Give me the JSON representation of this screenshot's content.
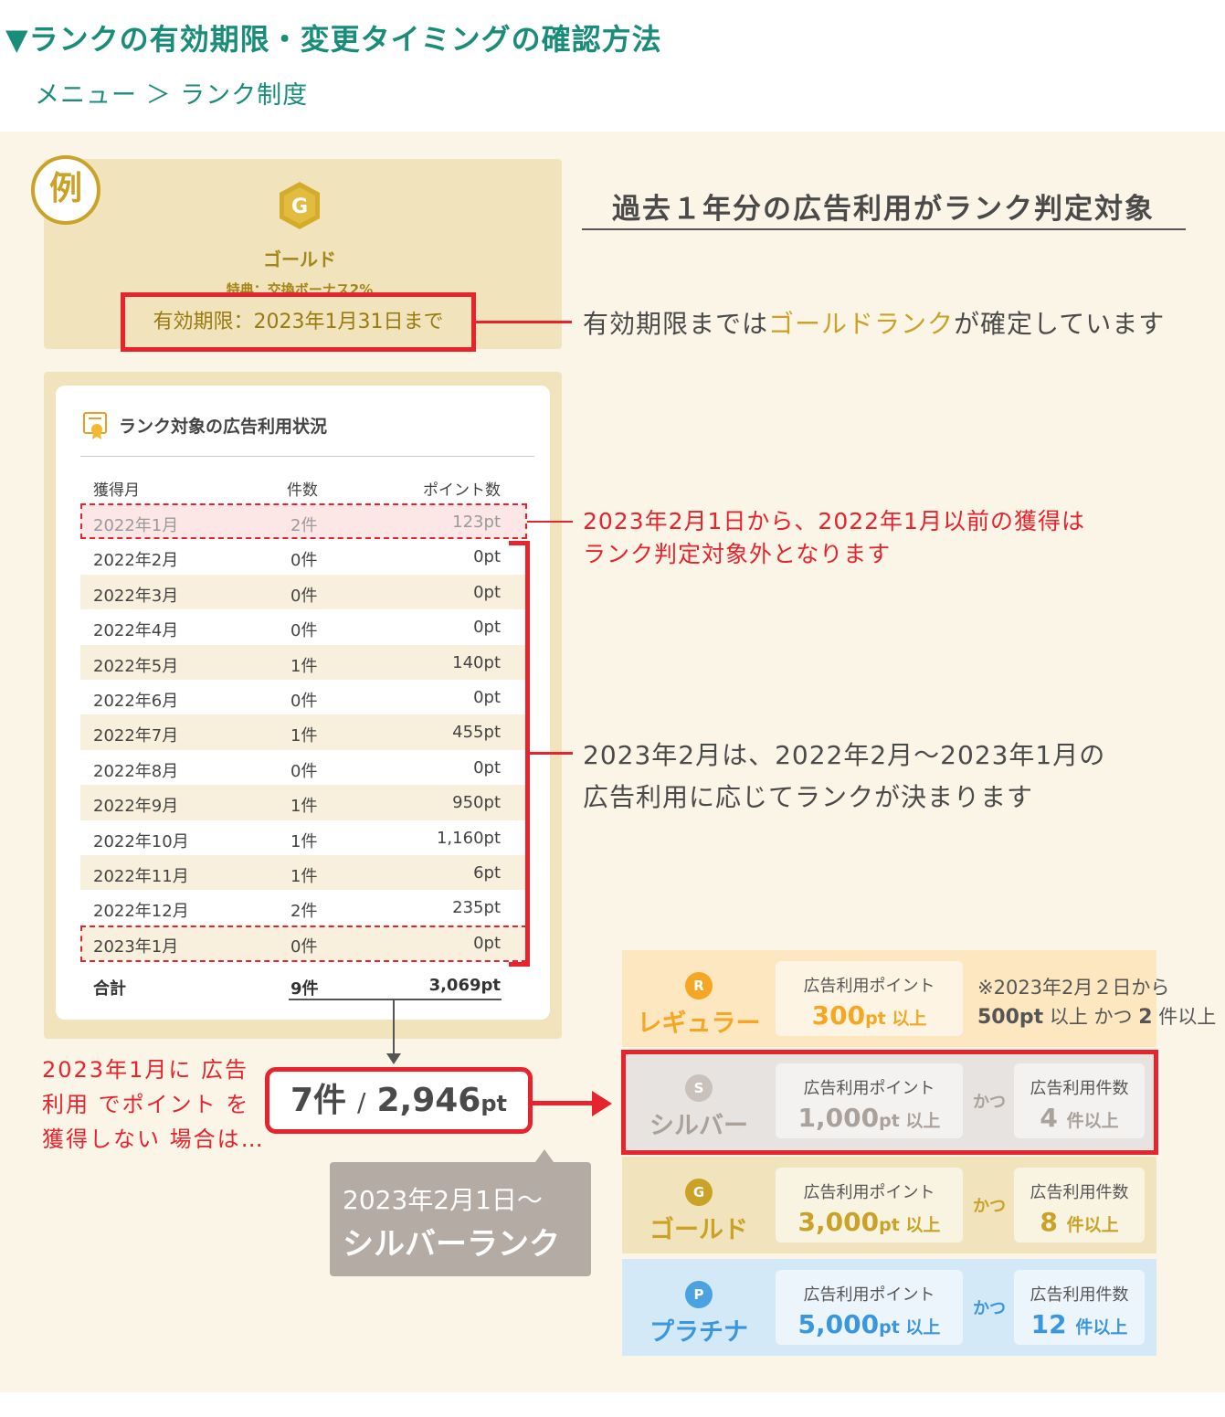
{
  "heading": "▼ランクの有効期限・変更タイミングの確認方法",
  "breadcrumb": "メニュー ＞ ランク制度",
  "example_badge": "例",
  "current_rank": {
    "medal_letter": "G",
    "name": "ゴールド",
    "perk": "特典：交換ボーナス2%",
    "expiry": "有効期限：2023年1月31日まで"
  },
  "annotations": {
    "title": "過去１年分の広告利用がランク判定対象",
    "expiry_prefix": "有効期限までは",
    "expiry_highlight": "ゴールドランク",
    "expiry_suffix": "が確定しています",
    "excluded_line1": "2023年2月1日から、2022年1月以前の獲得は",
    "excluded_line2": "ランク判定対象外となります",
    "period_line1": "2023年2月は、2022年2月〜2023年1月の",
    "period_line2": "広告利用に応じてランクが決まります"
  },
  "table": {
    "title": "ランク対象の広告利用状況",
    "headers": {
      "month": "獲得月",
      "count": "件数",
      "points": "ポイント数"
    },
    "rows": [
      {
        "month": "2022年1月",
        "count": "2件",
        "points": "123pt"
      },
      {
        "month": "2022年2月",
        "count": "0件",
        "points": "0pt"
      },
      {
        "month": "2022年3月",
        "count": "0件",
        "points": "0pt"
      },
      {
        "month": "2022年4月",
        "count": "0件",
        "points": "0pt"
      },
      {
        "month": "2022年5月",
        "count": "1件",
        "points": "140pt"
      },
      {
        "month": "2022年6月",
        "count": "0件",
        "points": "0pt"
      },
      {
        "month": "2022年7月",
        "count": "1件",
        "points": "455pt"
      },
      {
        "month": "2022年8月",
        "count": "0件",
        "points": "0pt"
      },
      {
        "month": "2022年9月",
        "count": "1件",
        "points": "950pt"
      },
      {
        "month": "2022年10月",
        "count": "1件",
        "points": "1,160pt"
      },
      {
        "month": "2022年11月",
        "count": "1件",
        "points": "6pt"
      },
      {
        "month": "2022年12月",
        "count": "2件",
        "points": "235pt"
      },
      {
        "month": "2023年1月",
        "count": "0件",
        "points": "0pt"
      }
    ],
    "total": {
      "label": "合計",
      "count": "9件",
      "points": "3,069pt"
    }
  },
  "scenario": {
    "line1": "2023年1月に 広告",
    "line2": "利用 でポイント を",
    "line3": "獲得しない 場合は…"
  },
  "result": {
    "count": "7件",
    "slash": "/",
    "points": "2,946",
    "unit": "pt"
  },
  "new_rank": {
    "date": "2023年2月1日〜",
    "rank": "シルバーランク"
  },
  "tiers": {
    "and_label": "かつ",
    "points_label": "広告利用ポイント",
    "count_label": "広告利用件数",
    "regular": {
      "badge": "R",
      "name": "レギュラー",
      "points": "300",
      "points_unit": "pt 以上",
      "note_line1": "※2023年2月２日から",
      "note_points": "500pt",
      "note_mid": "以上 かつ",
      "note_count": "2",
      "note_end": "件以上"
    },
    "silver": {
      "badge": "S",
      "name": "シルバー",
      "points": "1,000",
      "points_unit": "pt 以上",
      "count": "4",
      "count_unit": "件以上"
    },
    "gold": {
      "badge": "G",
      "name": "ゴールド",
      "points": "3,000",
      "points_unit": "pt 以上",
      "count": "8",
      "count_unit": "件以上"
    },
    "platinum": {
      "badge": "P",
      "name": "プラチナ",
      "points": "5,000",
      "points_unit": "pt 以上",
      "count": "12",
      "count_unit": "件以上"
    }
  },
  "colors": {
    "accent_teal": "#1a8c7a",
    "alert_red": "#e7232d",
    "gold": "#c9a227",
    "regular": "#f5a623",
    "silver": "#a9a19a",
    "platinum": "#3b97dd"
  },
  "icons": {
    "table_icon": "certificate-icon",
    "medal": "gold-medal-icon"
  }
}
